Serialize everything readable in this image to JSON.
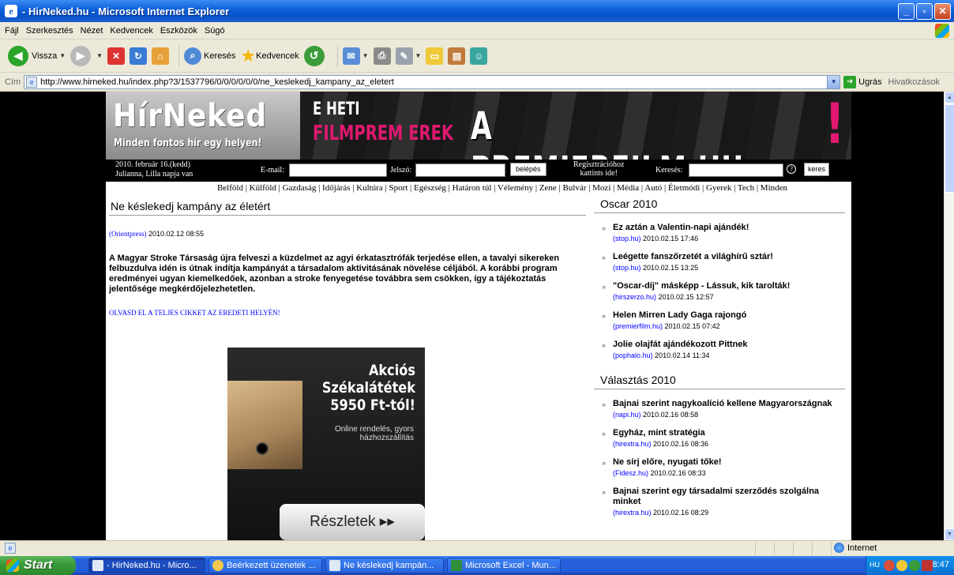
{
  "window": {
    "title": "- HirNeked.hu - Microsoft Internet Explorer"
  },
  "menu": [
    "Fájl",
    "Szerkesztés",
    "Nézet",
    "Kedvencek",
    "Eszközök",
    "Súgó"
  ],
  "toolbar": {
    "back": "Vissza",
    "search": "Keresés",
    "favorites": "Kedvencek"
  },
  "address": {
    "label": "Cím",
    "url": "http://www.hirneked.hu/index.php?3/1537796/0/0/0/0/0/0/ne_keslekedj_kampany_az_eletert",
    "go": "Ugrás",
    "links": "Hivatkozások"
  },
  "site": {
    "logo": "HírNeked",
    "tagline": "Minden fontos hír egy helyen!",
    "banner_line1": "E HETI",
    "banner_line2": "FILMPREM EREK",
    "banner_main": "A PREMIERFILM.HU-N",
    "banner_excl": "!",
    "date": "2010. február 16.(kedd)",
    "nameday": "Julianna, Lilla napja van",
    "email_label": "E-mail:",
    "password_label": "Jelszó:",
    "login_button": "belépés",
    "register_line1": "Regisztrációhoz",
    "register_line2": "kattints ide!",
    "search_label": "Keresés:",
    "help": "?",
    "search_button": "keres",
    "categories": "Belföld | Külföld | Gazdaság | Időjárás | Kultúra | Sport | Egészség | Határon túl | Vélemény | Zene | Bulvár | Mozi | Média | Autó | Életmódi | Gyerek | Tech | Minden"
  },
  "article": {
    "title": "Ne késlekedj kampány az életért",
    "source": "(Orientpress)",
    "datetime": "2010.02.12 08:55",
    "body": "A Magyar Stroke Társaság újra felveszi a küzdelmet az agyi érkatasztrófák terjedése ellen, a tavalyi sikereken felbuzdulva idén is útnak indítja kampányát a társadalom aktivitásának növelése céljából. A korábbi program eredményei ugyan kiemelkedőek, azonban a stroke fenyegetése továbbra sem csökken, így a tájékoztatás jelentősége megkérdőjelezhetetlen.",
    "readmore": "OLVASD EL A TELJES CIKKET AZ EREDETI HELYÉN!"
  },
  "ad": {
    "headline1": "Akciós",
    "headline2": "Székalátétek",
    "headline3": "5950 Ft-tól!",
    "sub1": "Online rendelés, gyors",
    "sub2": "házhozszállítás",
    "button": "Részletek ▸▸"
  },
  "sidebar": {
    "sections": [
      {
        "title": "Oscar 2010",
        "items": [
          {
            "title": "Ez aztán a Valentin-napi ajándék!",
            "source": "(stop.hu)",
            "datetime": "2010.02.15 17:46"
          },
          {
            "title": "Leégette fanszőrzetét a világhírű sztár!",
            "source": "(stop.hu)",
            "datetime": "2010.02.15 13:25"
          },
          {
            "title": "\"Oscar-díj\" másképp - Lássuk, kik tarolták!",
            "source": "(hirszerzo.hu)",
            "datetime": "2010.02.15 12:57"
          },
          {
            "title": "Helen Mirren Lady Gaga rajongó",
            "source": "(premierfilm.hu)",
            "datetime": "2010.02.15 07:42"
          },
          {
            "title": "Jolie olajfát ajándékozott Pittnek",
            "source": "(pophalo.hu)",
            "datetime": "2010.02.14 11:34"
          }
        ]
      },
      {
        "title": "Választás 2010",
        "items": [
          {
            "title": "Bajnai szerint nagykoalíció kellene Magyarországnak",
            "source": "(napi.hu)",
            "datetime": "2010.02.16 08:58"
          },
          {
            "title": "Egyház, mint stratégia",
            "source": "(hirextra.hu)",
            "datetime": "2010.02.16 08:36"
          },
          {
            "title": "Ne sírj előre, nyugati tőke!",
            "source": "(Fidesz.hu)",
            "datetime": "2010.02.16 08:33"
          },
          {
            "title": "Bajnai szerint egy társadalmi szerződés szolgálna minket",
            "source": "(hirextra.hu)",
            "datetime": "2010.02.16 08:29"
          }
        ]
      }
    ]
  },
  "status": {
    "zone": "Internet"
  },
  "taskbar": {
    "start": "Start",
    "tasks": [
      "- HirNeked.hu - Micro...",
      "Beérkezett üzenetek ...",
      "Ne késlekedj kampán...",
      "Microsoft Excel - Mun..."
    ],
    "lang": "HU",
    "clock": "8:47"
  }
}
